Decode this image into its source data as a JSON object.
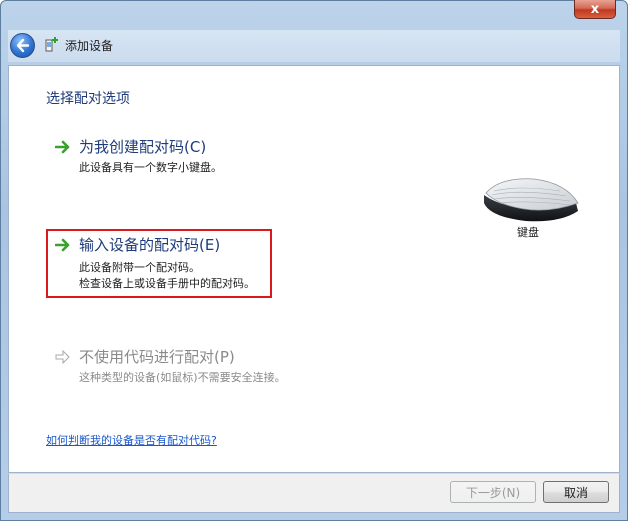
{
  "window": {
    "title": "添加设备",
    "close_label": "x"
  },
  "main": {
    "heading": "选择配对选项",
    "options": [
      {
        "title": "为我创建配对码(C)",
        "descriptions": [
          "此设备具有一个数字小键盘。"
        ]
      },
      {
        "title": "输入设备的配对码(E)",
        "descriptions": [
          "此设备附带一个配对码。",
          "检查设备上或设备手册中的配对码。"
        ]
      },
      {
        "title": "不使用代码进行配对(P)",
        "descriptions": [
          "这种类型的设备(如鼠标)不需要安全连接。"
        ]
      }
    ],
    "device": {
      "icon": "keyboard-icon",
      "label": "键盘"
    },
    "help_link": "如何判断我的设备是否有配对代码?"
  },
  "footer": {
    "next_label": "下一步(N)",
    "cancel_label": "取消"
  },
  "colors": {
    "accent": "#1e3c7a",
    "link": "#1a57c8",
    "highlight": "#d9191c",
    "arrow_green": "#3aa12e"
  }
}
